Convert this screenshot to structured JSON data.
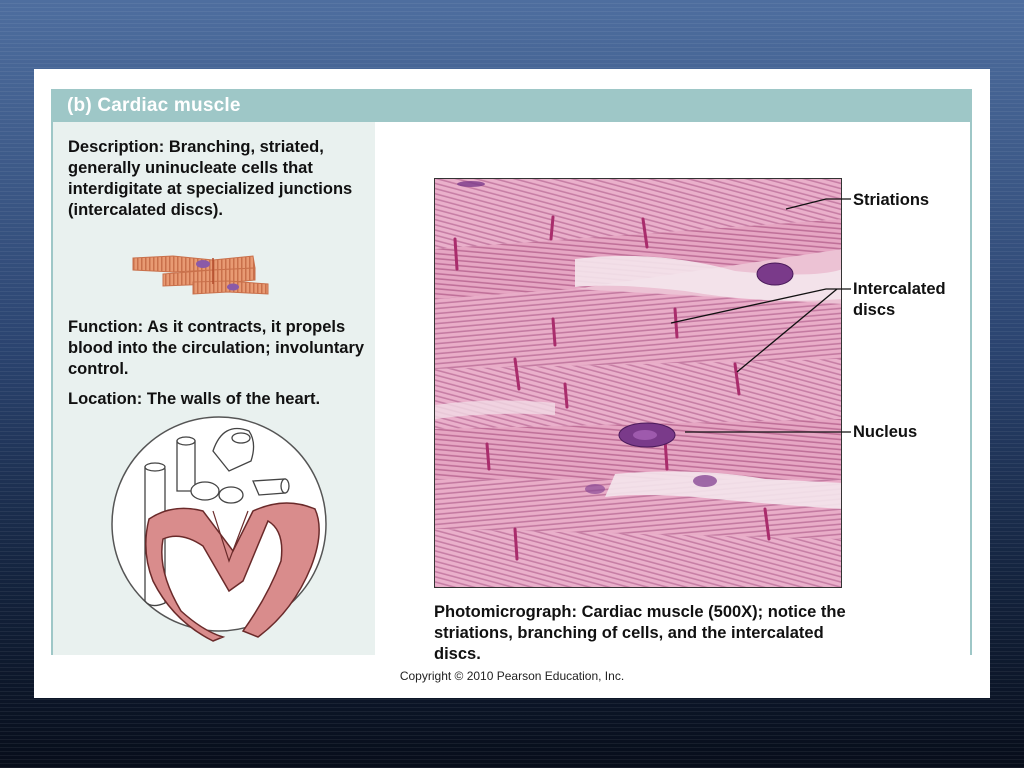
{
  "header": {
    "title": "(b) Cardiac muscle"
  },
  "description": {
    "label": "Description:",
    "text": "Branching, striated, generally uninucleate cells that interdigitate at specialized junctions (intercalated discs)."
  },
  "function": {
    "label": "Function:",
    "text": "As it contracts, it propels blood into the circulation; involuntary control."
  },
  "location": {
    "label": "Location:",
    "text": "The walls of the heart."
  },
  "labels": {
    "striations": "Striations",
    "intercalated_discs": "Intercalated discs",
    "nucleus": "Nucleus"
  },
  "caption": {
    "label": "Photomicrograph:",
    "text": "Cardiac muscle (500X); notice the striations, branching of cells, and the intercalated discs."
  },
  "copyright": "Copyright © 2010 Pearson Education, Inc.",
  "colors": {
    "header_bg": "#9ec7c7",
    "left_col_bg": "#e9f1ef",
    "tissue_pink": "#e7a9c6",
    "disc_magenta": "#b0306f",
    "heart_muscle": "#d98c8c"
  }
}
